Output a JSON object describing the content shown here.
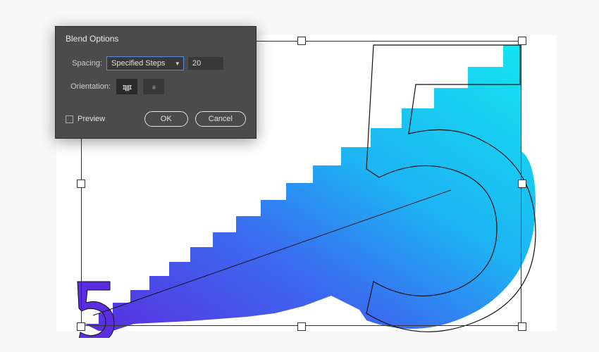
{
  "dialog": {
    "title": "Blend Options",
    "spacing_label": "Spacing:",
    "spacing_mode": "Specified Steps",
    "spacing_value": "20",
    "orientation_label": "Orientation:",
    "orientation_align_page_glyph": "ɪꞁꞁꞁɪ",
    "orientation_align_path_glyph": "ᵢᵢᵢᵢᵢ",
    "preview_label": "Preview",
    "preview_checked": false,
    "ok_label": "OK",
    "cancel_label": "Cancel"
  },
  "artwork": {
    "blend_steps": 20,
    "glyph": "5",
    "colors": {
      "start": "#5a2de0",
      "end": "#14e6ef",
      "mid": "#2a8ff0"
    }
  }
}
